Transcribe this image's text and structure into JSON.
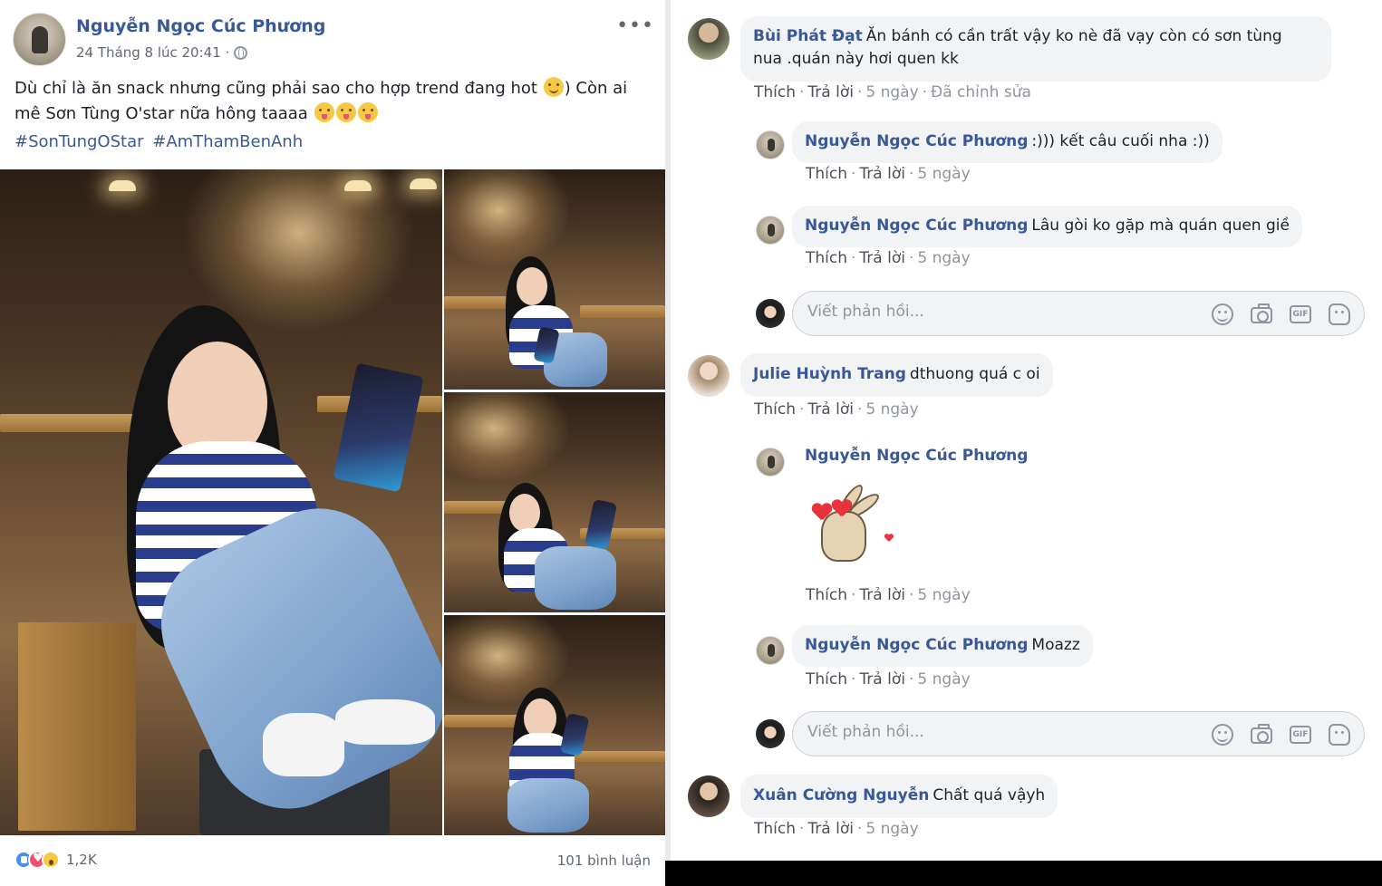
{
  "post": {
    "author": "Nguyễn Ngọc Cúc Phương",
    "timestamp": "24 Tháng 8 lúc 20:41 ·",
    "more": "•••",
    "text_line1_a": "Dù chỉ là ăn snack nhưng cũng phải sao cho hợp trend đang hot",
    "text_line1_b": ") Còn ai",
    "text_line2": "mê Sơn Tùng O'star nữa hông taaaa",
    "hashtags": [
      "#SonTungOStar",
      "#AmThamBenAnh"
    ],
    "photo_count": 4,
    "reactions": {
      "icons": [
        "like-icon",
        "love-icon",
        "wow-icon"
      ],
      "count": "1,2K"
    },
    "comment_count": "101 bình luận"
  },
  "labels": {
    "like": "Thích",
    "reply": "Trả lời",
    "reply_placeholder": "Viết phản hồi...",
    "gif": "GIF"
  },
  "comments": [
    {
      "name": "Bùi Phát Đạt",
      "text_line1": "Ăn bánh có cần trất vậy ko nè đã vạy còn có sơn tùng",
      "text_line2": "nua .quán này hơi quen kk",
      "time": "5 ngày",
      "edited": "Đã chỉnh sửa",
      "replies": [
        {
          "name": "Nguyễn Ngọc Cúc Phương",
          "text": ":))) kết câu cuối nha :))",
          "time": "5 ngày"
        },
        {
          "name": "Nguyễn Ngọc Cúc Phương",
          "text": "Lâu gòi ko gặp mà quán quen giề",
          "time": "5 ngày"
        }
      ]
    },
    {
      "name": "Julie Huỳnh Trang",
      "text": "dthuong quá c oi",
      "time": "5 ngày",
      "replies": [
        {
          "name": "Nguyễn Ngọc Cúc Phương",
          "sticker": "bunny-heart-eyes-sticker",
          "time": "5 ngày"
        },
        {
          "name": "Nguyễn Ngọc Cúc Phương",
          "text": "Moazz",
          "time": "5 ngày"
        }
      ]
    },
    {
      "name": "Xuân Cường Nguyễn",
      "text": "Chất quá vậyh",
      "time": "5 ngày"
    }
  ],
  "colors": {
    "link": "#385898",
    "bubble": "#f2f3f5",
    "meta": "#90949c"
  }
}
